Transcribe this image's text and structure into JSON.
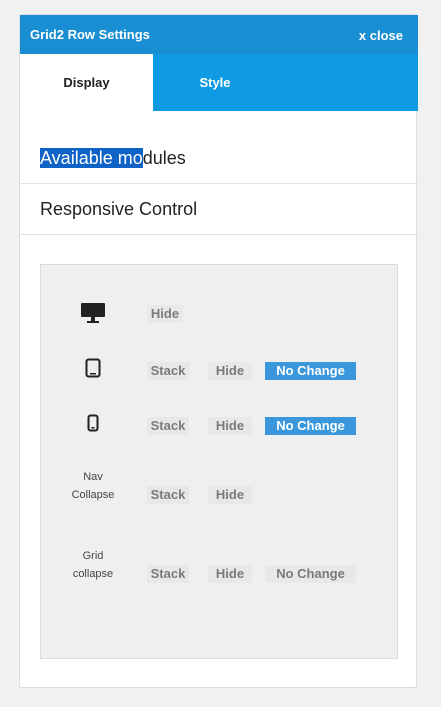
{
  "header": {
    "title": "Grid2 Row Settings",
    "close_label": "x close",
    "accent_color": "#1a8ed2"
  },
  "tabs": [
    {
      "label": "Display",
      "active": true
    },
    {
      "label": "Style",
      "active": false
    }
  ],
  "sections": {
    "available_modules": {
      "label_selected": "Available mo",
      "label_rest": "dules"
    },
    "responsive_control": {
      "label": "Responsive Control"
    }
  },
  "responsive": {
    "active_color": "#3b97db",
    "rows": [
      {
        "id": "desktop",
        "icon": "desktop-icon",
        "options": [
          {
            "label": "Hide",
            "active": false
          }
        ]
      },
      {
        "id": "tablet",
        "icon": "tablet-icon",
        "options": [
          {
            "label": "Stack",
            "active": false
          },
          {
            "label": "Hide",
            "active": false
          },
          {
            "label": "No Change",
            "active": true
          }
        ]
      },
      {
        "id": "phone",
        "icon": "phone-icon",
        "options": [
          {
            "label": "Stack",
            "active": false
          },
          {
            "label": "Hide",
            "active": false
          },
          {
            "label": "No Change",
            "active": true
          }
        ]
      },
      {
        "id": "nav-collapse",
        "label_line1": "Nav",
        "label_line2": "Collapse",
        "options": [
          {
            "label": "Stack",
            "active": false
          },
          {
            "label": "Hide",
            "active": false
          }
        ]
      },
      {
        "id": "grid-collapse",
        "label_line1": "Grid",
        "label_line2": "collapse",
        "options": [
          {
            "label": "Stack",
            "active": false
          },
          {
            "label": "Hide",
            "active": false
          },
          {
            "label": "No Change",
            "active": false
          }
        ]
      }
    ]
  }
}
